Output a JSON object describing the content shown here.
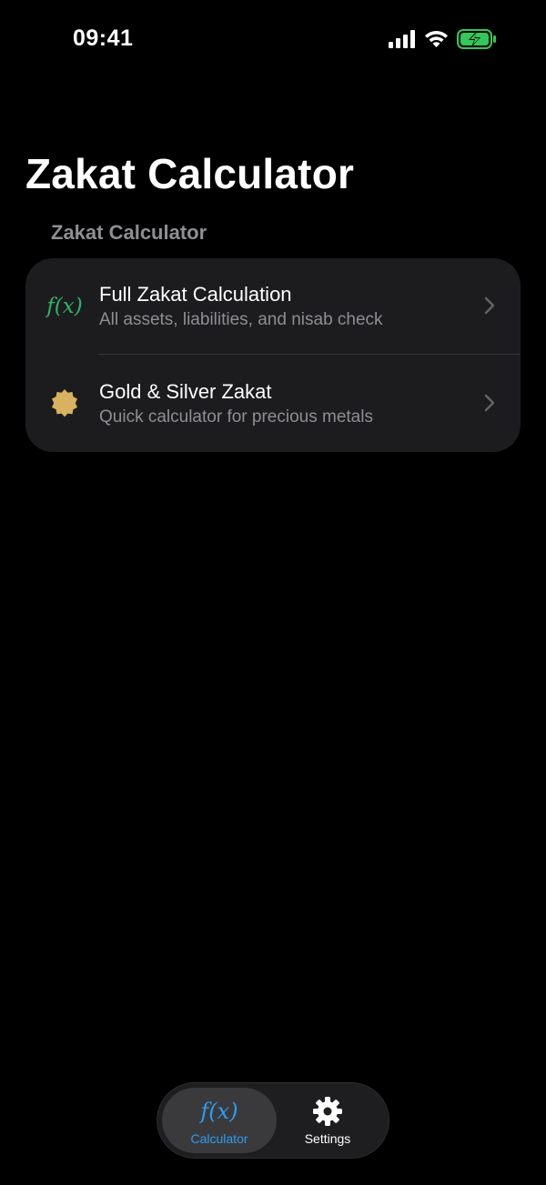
{
  "status_bar": {
    "time": "09:41",
    "icons": [
      "cellular-signal-icon",
      "wifi-icon",
      "battery-charging-icon"
    ]
  },
  "nav": {
    "large_title": "Zakat Calculator"
  },
  "section": {
    "header": "Zakat Calculator",
    "rows": [
      {
        "icon": "fx-function-icon",
        "icon_text": "f(x)",
        "title": "Full Zakat Calculation",
        "subtitle": "All assets, liabilities, and nisab check"
      },
      {
        "icon": "seal-badge-icon",
        "title": "Gold & Silver Zakat",
        "subtitle": "Quick calculator for precious metals"
      }
    ]
  },
  "tab_bar": {
    "tabs": [
      {
        "icon": "fx-function-icon",
        "icon_text": "f(x)",
        "label": "Calculator",
        "selected": true
      },
      {
        "icon": "gear-icon",
        "label": "Settings",
        "selected": false
      }
    ]
  },
  "colors": {
    "background": "#000000",
    "card": "#1c1c1e",
    "secondary_text": "#8e8e93",
    "fx_green": "#2fb36a",
    "gold": "#d9b25f",
    "accent_blue": "#2e9bf0",
    "battery_green": "#34c759"
  }
}
